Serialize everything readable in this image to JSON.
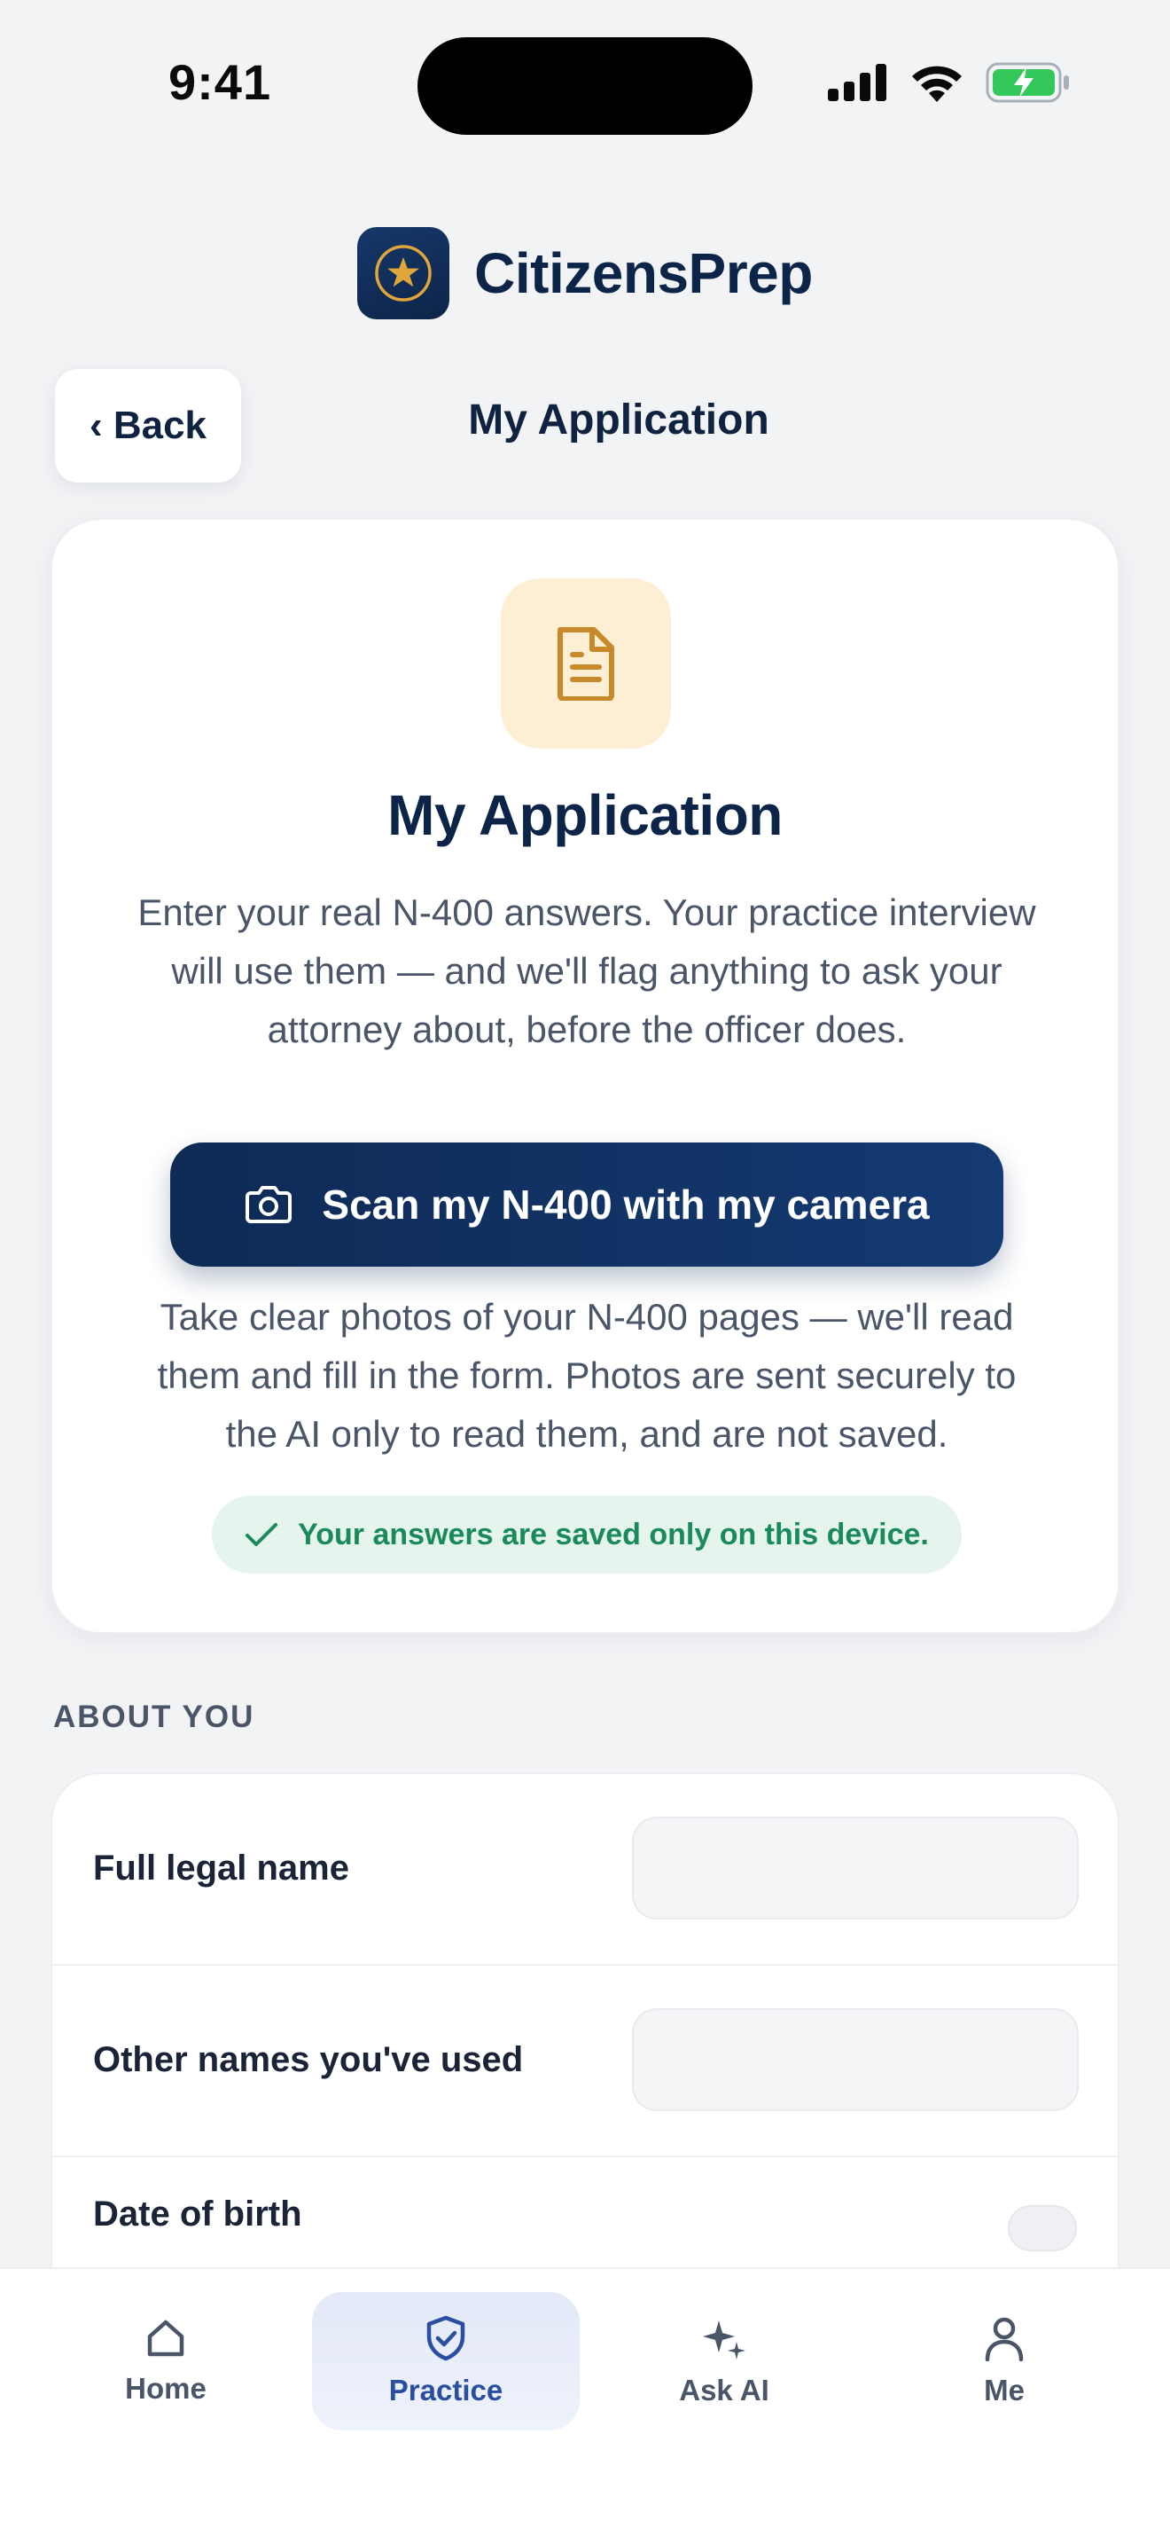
{
  "status_bar": {
    "time": "9:41"
  },
  "brand": {
    "name": "CitizensPrep",
    "logo_icon": "star-badge-icon"
  },
  "header": {
    "back_label": "‹ Back",
    "title": "My Application"
  },
  "hero": {
    "icon": "document-icon",
    "title": "My Application",
    "description": "Enter your real N-400 answers. Your practice interview will use them — and we'll flag anything to ask your attorney about, before the officer does.",
    "scan_button_label": "Scan my N-400 with my camera",
    "scan_note": "Take clear photos of your N-400 pages — we'll read them and fill in the form. Photos are sent securely to the AI only to read them, and are not saved.",
    "saved_notice": "Your answers are saved only on this device."
  },
  "section": {
    "label": "ABOUT YOU",
    "fields": [
      {
        "label": "Full legal name",
        "value": "",
        "placeholder": ""
      },
      {
        "label": "Other names you've used",
        "value": "",
        "placeholder": ""
      },
      {
        "label": "Date of birth",
        "value": ""
      }
    ]
  },
  "bottom_nav": {
    "items": [
      {
        "label": "Home",
        "icon": "home-icon",
        "active": false
      },
      {
        "label": "Practice",
        "icon": "shield-check-icon",
        "active": true
      },
      {
        "label": "Ask AI",
        "icon": "sparkles-icon",
        "active": false
      },
      {
        "label": "Me",
        "icon": "person-icon",
        "active": false
      }
    ]
  },
  "colors": {
    "primary": "#0e2a55",
    "accent_gold": "#c8892a",
    "success": "#1a8a5a",
    "nav_active": "#2a4fa0",
    "background": "#f2f3f5"
  }
}
